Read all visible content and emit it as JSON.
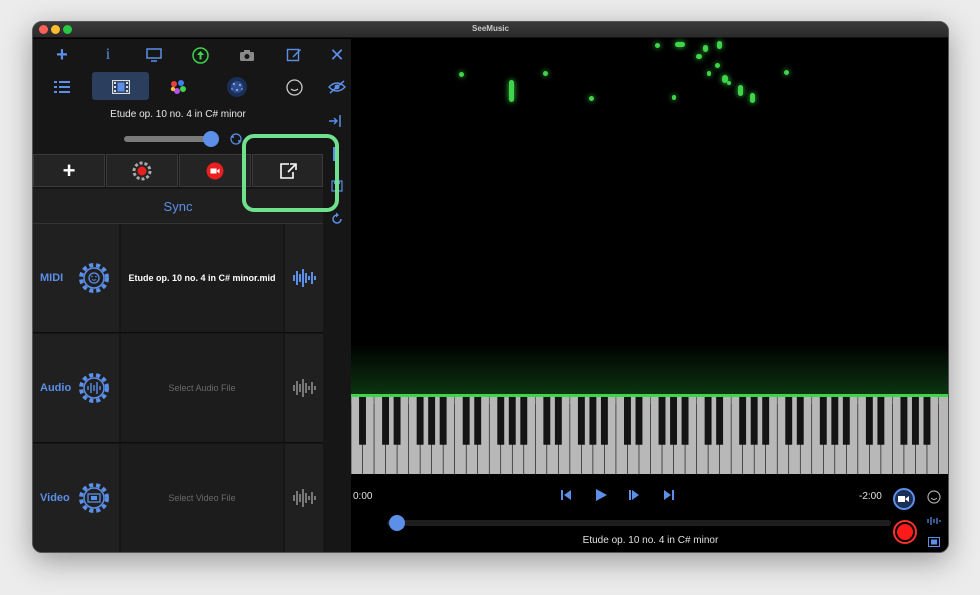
{
  "window": {
    "title": "SeeMusic"
  },
  "toolbar": {
    "icons": [
      "plus-icon",
      "info-icon",
      "monitor-icon",
      "upload-icon",
      "camera-icon",
      "edit-icon",
      "close-icon"
    ],
    "tabs": [
      "list-icon",
      "film-icon",
      "palette-icon",
      "particles-icon",
      "face-icon",
      "eye-slash-icon"
    ]
  },
  "song": {
    "title": "Etude op. 10 no. 4 in C# minor"
  },
  "actions": {
    "icons": [
      "plus-icon",
      "gear-record-icon",
      "record-video-icon",
      "share-icon"
    ]
  },
  "sync": {
    "label": "Sync"
  },
  "tracks": [
    {
      "label": "MIDI",
      "file": "Etude op. 10 no. 4 in C# minor.mid",
      "file_active": true
    },
    {
      "label": "Audio",
      "file": "Select Audio File",
      "file_active": false
    },
    {
      "label": "Video",
      "file": "Select Video File",
      "file_active": false
    }
  ],
  "player": {
    "time_current": "0:00",
    "time_remaining": "-2:00",
    "title": "Etude op. 10 no. 4 in C# minor",
    "progress": 0.0
  },
  "colors": {
    "accent": "#5b8fe8",
    "notes": "#3fd44a",
    "record": "#ff1a1a",
    "highlight": "#6ee08e"
  }
}
